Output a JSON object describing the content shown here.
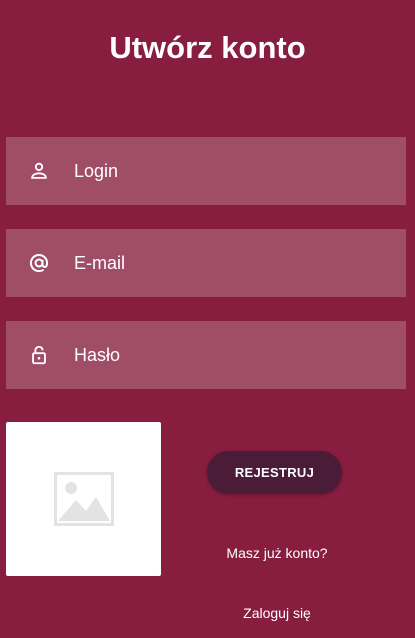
{
  "header": {
    "title": "Utwórz konto"
  },
  "form": {
    "login": {
      "placeholder": "Login",
      "value": "",
      "icon": "person-icon"
    },
    "email": {
      "placeholder": "E-mail",
      "value": "",
      "icon": "at-sign-icon"
    },
    "password": {
      "placeholder": "Hasło",
      "value": "",
      "icon": "lock-icon"
    }
  },
  "image": {
    "icon": "image-placeholder-icon"
  },
  "actions": {
    "register_label": "REJESTRUJ",
    "have_account_text": "Masz już konto?",
    "login_link_label": "Zaloguj się"
  },
  "colors": {
    "background": "#871d3f",
    "field_background": "#a04e68",
    "button_background": "#4a1c37",
    "text": "#ffffff"
  }
}
